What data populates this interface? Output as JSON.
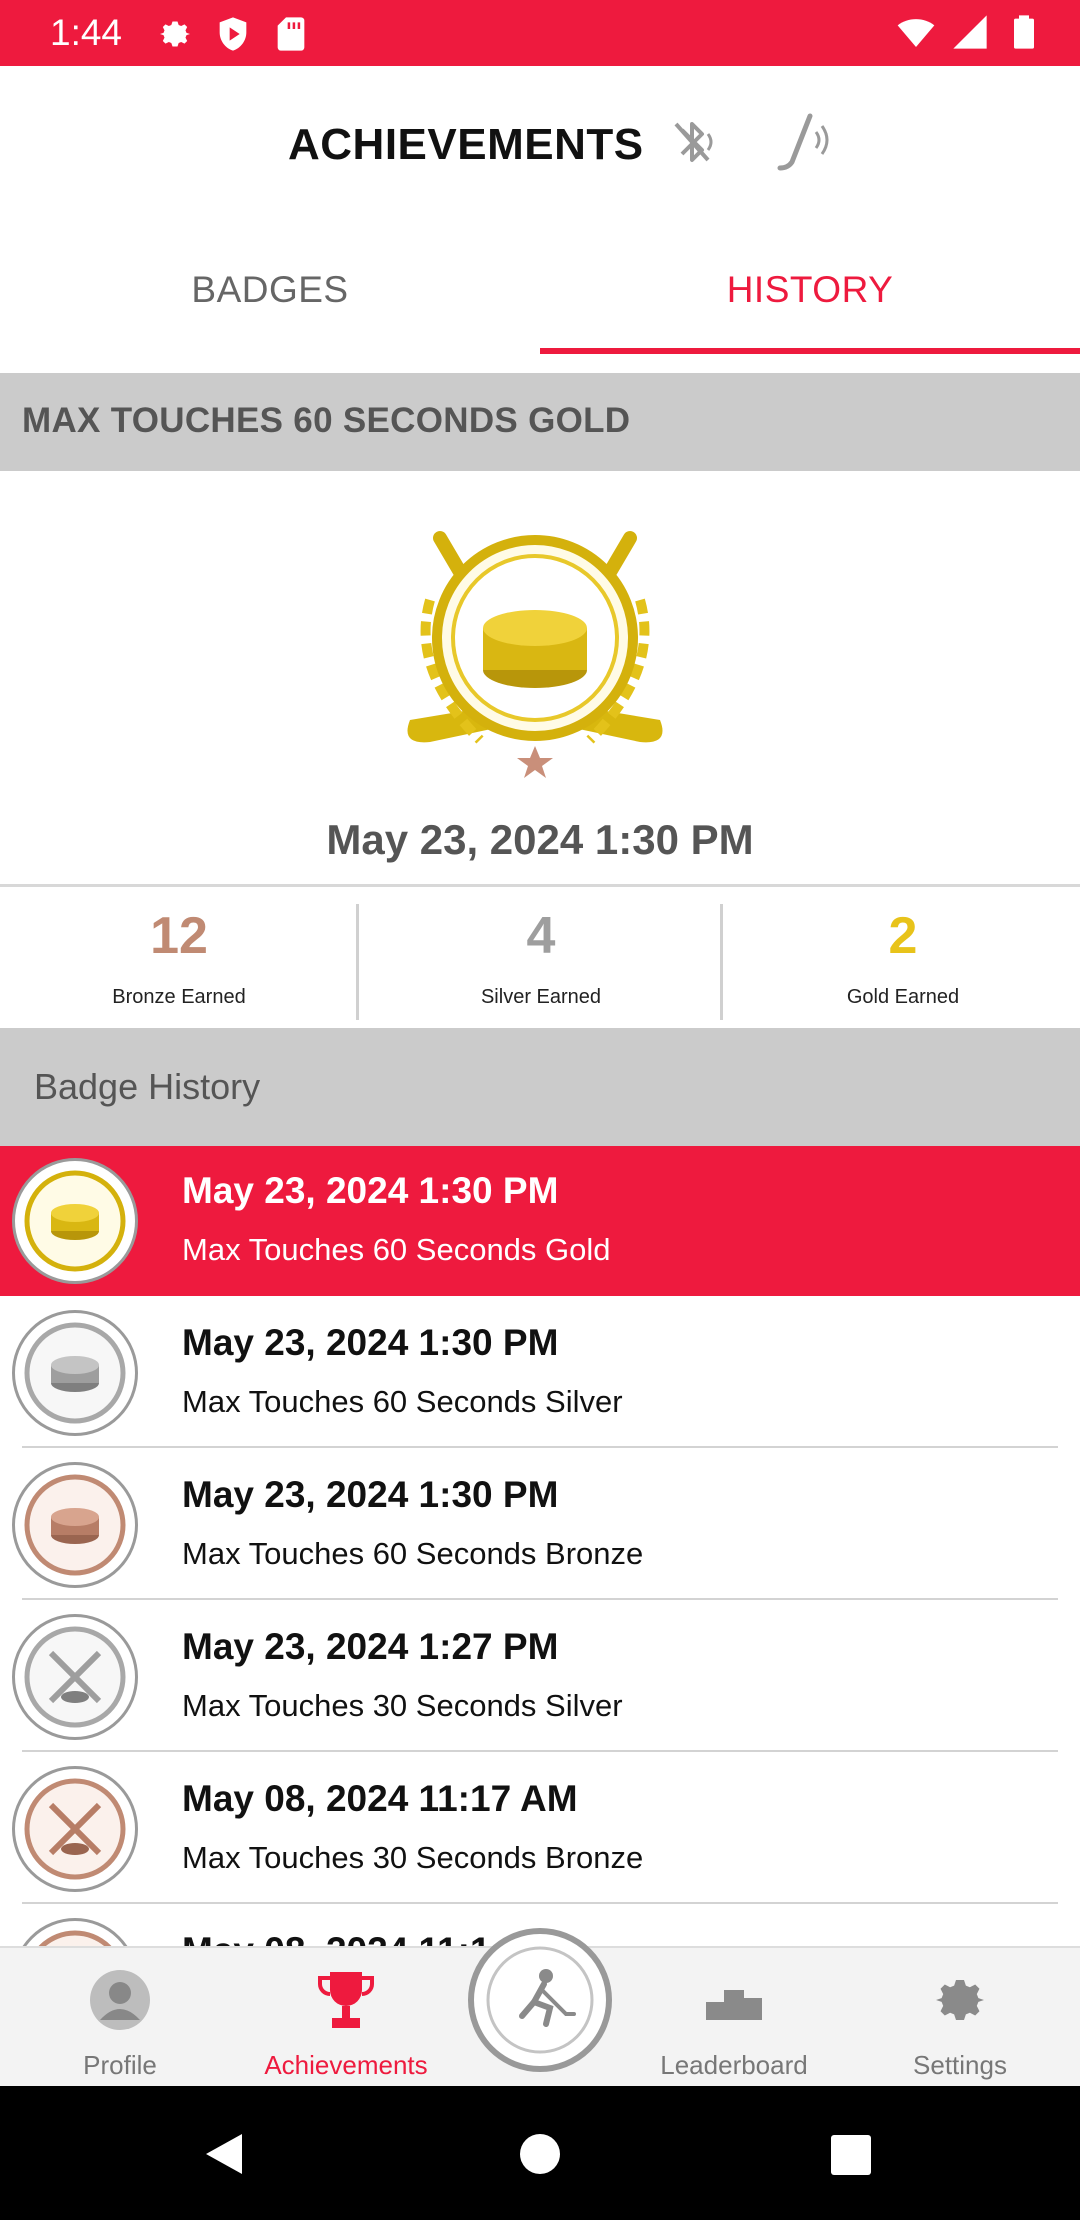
{
  "status_bar": {
    "time": "1:44"
  },
  "header": {
    "title": "ACHIEVEMENTS"
  },
  "tabs": [
    {
      "label": "BADGES",
      "active": false
    },
    {
      "label": "HISTORY",
      "active": true
    }
  ],
  "featured": {
    "section_title": "MAX TOUCHES 60 SECONDS GOLD",
    "date": "May 23, 2024 1:30 PM",
    "badge_icon": "gold-puck-badge"
  },
  "stats": [
    {
      "value": "12",
      "label": "Bronze Earned",
      "color": "#c08a73"
    },
    {
      "value": "4",
      "label": "Silver Earned",
      "color": "#9e9e9e"
    },
    {
      "value": "2",
      "label": "Gold Earned",
      "color": "#e8c31a"
    }
  ],
  "history": {
    "heading": "Badge History",
    "items": [
      {
        "date": "May 23, 2024 1:30 PM",
        "name": "Max Touches 60 Seconds Gold",
        "tier": "gold",
        "selected": true
      },
      {
        "date": "May 23, 2024 1:30 PM",
        "name": "Max Touches 60 Seconds Silver",
        "tier": "silver",
        "selected": false
      },
      {
        "date": "May 23, 2024 1:30 PM",
        "name": "Max Touches 60 Seconds Bronze",
        "tier": "bronze",
        "selected": false
      },
      {
        "date": "May 23, 2024 1:27 PM",
        "name": "Max Touches 30 Seconds Silver",
        "tier": "silver",
        "selected": false
      },
      {
        "date": "May 08, 2024 11:17 AM",
        "name": "Max Touches 30 Seconds Bronze",
        "tier": "bronze",
        "selected": false
      },
      {
        "date": "May 08, 2024 11:1…",
        "name": "",
        "tier": "bronze",
        "selected": false
      }
    ]
  },
  "bottom_nav": [
    {
      "label": "Profile",
      "icon": "profile-icon",
      "active": false
    },
    {
      "label": "Achievements",
      "icon": "trophy-icon",
      "active": true
    },
    {
      "label": "Leaderboard",
      "icon": "podium-icon",
      "active": false
    },
    {
      "label": "Settings",
      "icon": "gear-icon",
      "active": false
    }
  ],
  "colors": {
    "accent": "#ee1a3e",
    "gray_band": "#cbcbcb"
  }
}
